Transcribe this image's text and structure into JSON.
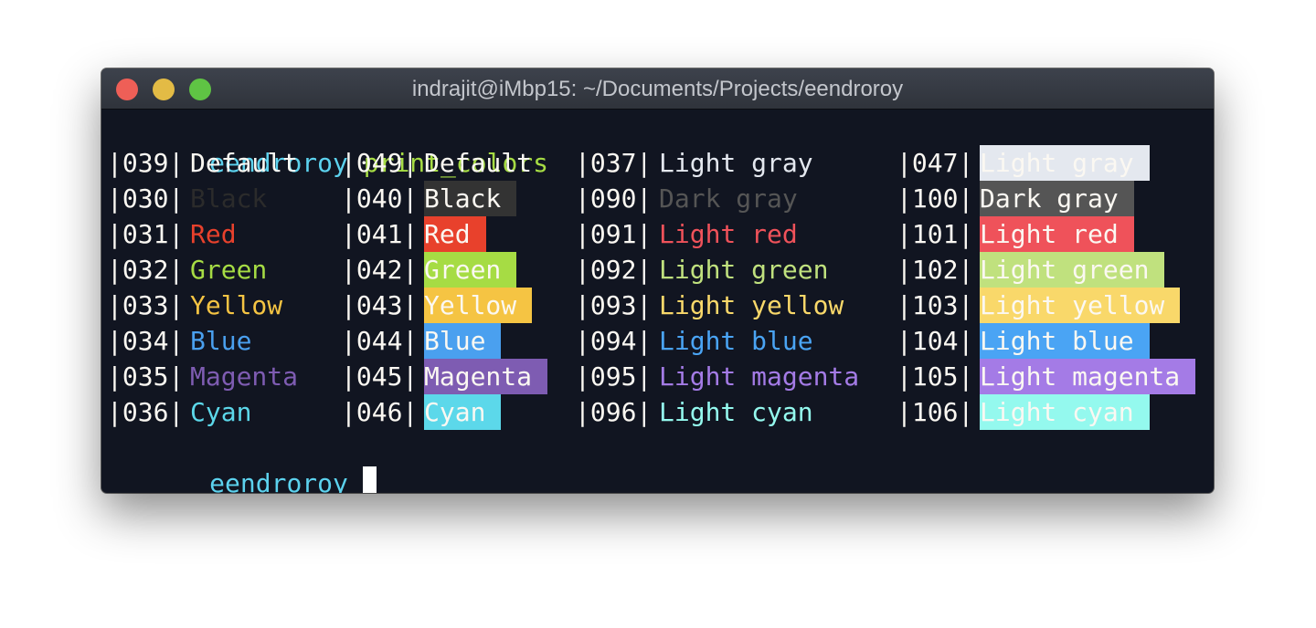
{
  "window": {
    "title": "indrajit@iMbp15: ~/Documents/Projects/eendroroy",
    "buttons": [
      "close",
      "minimize",
      "maximize"
    ]
  },
  "terminal": {
    "command_prompt": {
      "user": "eendroroy",
      "command": "print_colors"
    },
    "final_prompt": {
      "user": "eendroroy"
    },
    "colors": {
      "default_fg": "#fbf8f2",
      "black": "#333333",
      "red": "#e8412c",
      "green": "#a6dc44",
      "yellow": "#f5c443",
      "blue": "#4aa0ef",
      "magenta": "#7e5cb2",
      "cyan": "#5cd8ea",
      "light_gray": "#e4e8ef",
      "dark_gray": "#555555",
      "light_red": "#ef525a",
      "light_green": "#c0e17e",
      "light_yellow": "#f9d86a",
      "light_blue": "#4aa4f4",
      "light_magenta": "#a47be6",
      "light_cyan": "#94f9ee",
      "dark_black_fg": "#2b2b2b"
    },
    "rows": [
      [
        {
          "code": "|039|",
          "label": "Default",
          "fg": "#fbf8f2",
          "bg": null
        },
        {
          "code": "|049|",
          "label": "Default",
          "fg": "#fbf8f2",
          "bg": null
        },
        {
          "code": "|037|",
          "label": "Light gray",
          "fg": "#e4e8ef",
          "bg": null
        },
        {
          "code": "|047|",
          "label": "Light gray",
          "fg": "#fbf8f2",
          "bg": "#e4e8ef"
        }
      ],
      [
        {
          "code": "|030|",
          "label": "Black",
          "fg": "#2b2b2b",
          "bg": null
        },
        {
          "code": "|040|",
          "label": "Black",
          "fg": "#fbf8f2",
          "bg": "#333333"
        },
        {
          "code": "|090|",
          "label": "Dark gray",
          "fg": "#555555",
          "bg": null
        },
        {
          "code": "|100|",
          "label": "Dark gray",
          "fg": "#fbf8f2",
          "bg": "#555555"
        }
      ],
      [
        {
          "code": "|031|",
          "label": "Red",
          "fg": "#e8412c",
          "bg": null
        },
        {
          "code": "|041|",
          "label": "Red",
          "fg": "#fbf8f2",
          "bg": "#e8412c"
        },
        {
          "code": "|091|",
          "label": "Light red",
          "fg": "#ef525a",
          "bg": null
        },
        {
          "code": "|101|",
          "label": "Light red",
          "fg": "#fbf8f2",
          "bg": "#ef525a"
        }
      ],
      [
        {
          "code": "|032|",
          "label": "Green",
          "fg": "#a6dc44",
          "bg": null
        },
        {
          "code": "|042|",
          "label": "Green",
          "fg": "#fbf8f2",
          "bg": "#a6dc44"
        },
        {
          "code": "|092|",
          "label": "Light green",
          "fg": "#c0e17e",
          "bg": null
        },
        {
          "code": "|102|",
          "label": "Light green",
          "fg": "#fbf8f2",
          "bg": "#c0e17e"
        }
      ],
      [
        {
          "code": "|033|",
          "label": "Yellow",
          "fg": "#f5c443",
          "bg": null
        },
        {
          "code": "|043|",
          "label": "Yellow",
          "fg": "#fbf8f2",
          "bg": "#f5c443"
        },
        {
          "code": "|093|",
          "label": "Light yellow",
          "fg": "#f9d86a",
          "bg": null
        },
        {
          "code": "|103|",
          "label": "Light yellow",
          "fg": "#fbf8f2",
          "bg": "#f9d86a"
        }
      ],
      [
        {
          "code": "|034|",
          "label": "Blue",
          "fg": "#4aa0ef",
          "bg": null
        },
        {
          "code": "|044|",
          "label": "Blue",
          "fg": "#fbf8f2",
          "bg": "#4aa0ef"
        },
        {
          "code": "|094|",
          "label": "Light blue",
          "fg": "#4aa4f4",
          "bg": null
        },
        {
          "code": "|104|",
          "label": "Light blue",
          "fg": "#fbf8f2",
          "bg": "#4aa4f4"
        }
      ],
      [
        {
          "code": "|035|",
          "label": "Magenta",
          "fg": "#7e5cb2",
          "bg": null
        },
        {
          "code": "|045|",
          "label": "Magenta",
          "fg": "#fbf8f2",
          "bg": "#7e5cb2"
        },
        {
          "code": "|095|",
          "label": "Light magenta",
          "fg": "#a47be6",
          "bg": null
        },
        {
          "code": "|105|",
          "label": "Light magenta",
          "fg": "#fbf8f2",
          "bg": "#a47be6"
        }
      ],
      [
        {
          "code": "|036|",
          "label": "Cyan",
          "fg": "#5cd8ea",
          "bg": null
        },
        {
          "code": "|046|",
          "label": "Cyan",
          "fg": "#fbf8f2",
          "bg": "#5cd8ea"
        },
        {
          "code": "|096|",
          "label": "Light cyan",
          "fg": "#94f9ee",
          "bg": null
        },
        {
          "code": "|106|",
          "label": "Light cyan",
          "fg": "#fbf8f2",
          "bg": "#94f9ee"
        }
      ]
    ]
  }
}
